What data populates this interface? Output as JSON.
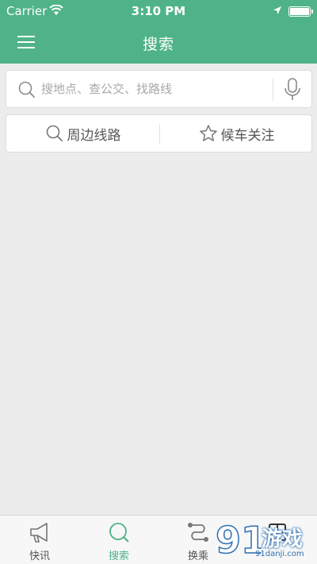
{
  "status_bar": {
    "carrier": "Carrier",
    "time": "3:10 PM"
  },
  "nav": {
    "title": "搜索"
  },
  "search": {
    "placeholder": "搜地点、查公交、找路线",
    "value": ""
  },
  "quick_actions": {
    "nearby_label": "周边线路",
    "follow_label": "候车关注"
  },
  "tabs": [
    {
      "label": "快讯",
      "icon": "megaphone-icon"
    },
    {
      "label": "搜索",
      "icon": "search-icon",
      "active": true
    },
    {
      "label": "换乘",
      "icon": "route-icon"
    },
    {
      "label": "",
      "icon": "grid-icon"
    }
  ],
  "watermark": {
    "text": "游戏",
    "url": "91danji.com"
  },
  "colors": {
    "brand_green": "#4fb387",
    "background": "#ececec"
  }
}
